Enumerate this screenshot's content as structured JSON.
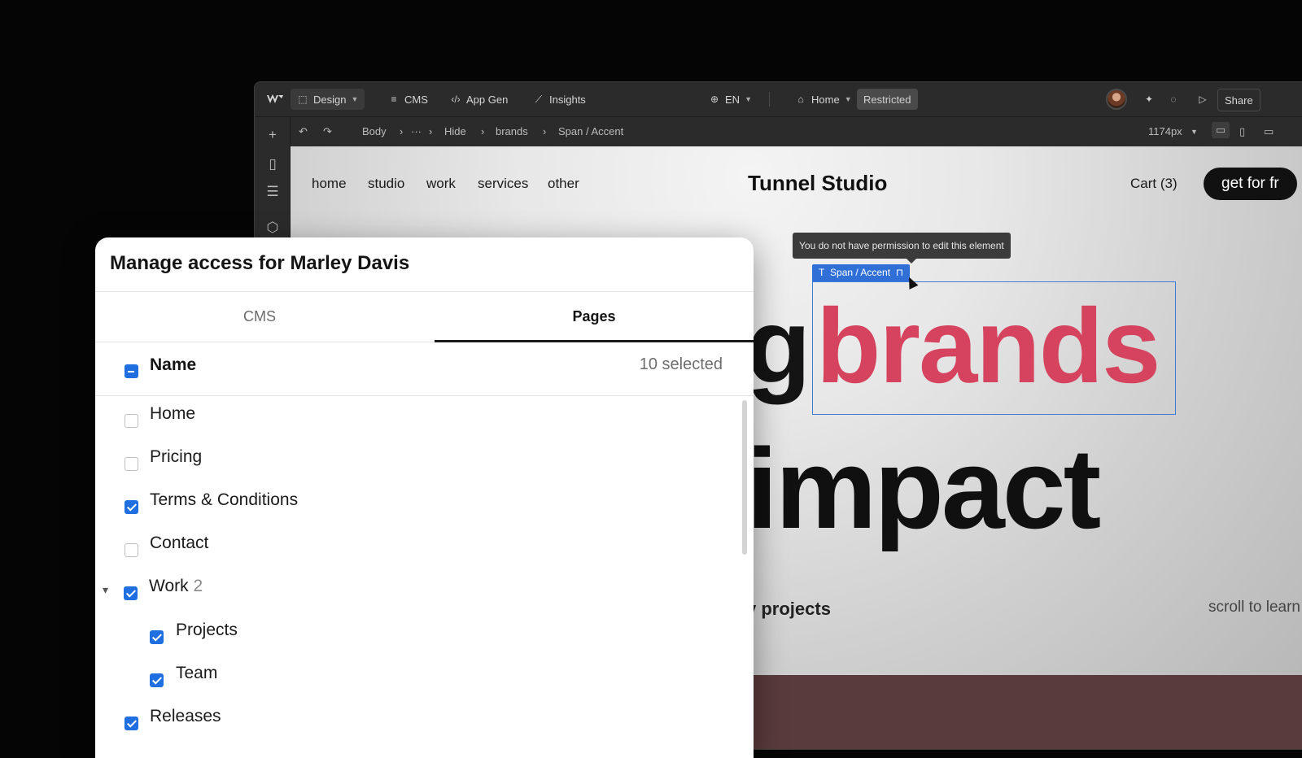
{
  "editor": {
    "topbar": {
      "design_label": "Design",
      "cms_label": "CMS",
      "appgen_label": "App Gen",
      "insights_label": "Insights",
      "lang_label": "EN",
      "page_label": "Home",
      "restricted_label": "Restricted",
      "share_label": "Share"
    },
    "breadcrumb": {
      "items": [
        "Body",
        "···",
        "Hide",
        "brands",
        "Span / Accent"
      ],
      "width_label": "1174px"
    }
  },
  "site": {
    "nav": [
      "home",
      "studio",
      "work",
      "services",
      "other"
    ],
    "title": "Tunnel Studio",
    "cart": "Cart  (3)",
    "cta": "get for fr",
    "headline_prefix": "g",
    "headline_accent": "brands",
    "headline_line2": "impact",
    "projects_text": "v projects",
    "scroll_text": "scroll to learn"
  },
  "selection": {
    "tooltip": "You do not have permission to edit this element",
    "tag_label": "Span / Accent",
    "accent_color": "#d6435f",
    "selection_color": "#2f6fd6"
  },
  "modal": {
    "title": "Manage access for Marley Davis",
    "tabs": [
      {
        "label": "CMS",
        "active": false
      },
      {
        "label": "Pages",
        "active": true
      }
    ],
    "header": {
      "label": "Name",
      "selected": "10 selected",
      "state": "mixed"
    },
    "rows": [
      {
        "label": "Home",
        "checked": false
      },
      {
        "label": "Pricing",
        "checked": false
      },
      {
        "label": "Terms & Conditions",
        "checked": true
      },
      {
        "label": "Contact",
        "checked": false
      },
      {
        "label": "Work",
        "count": "2",
        "checked": true,
        "expanded": true
      },
      {
        "label": "Projects",
        "checked": true,
        "child": true
      },
      {
        "label": "Team",
        "checked": true,
        "child": true
      },
      {
        "label": "Releases",
        "checked": true
      }
    ]
  }
}
